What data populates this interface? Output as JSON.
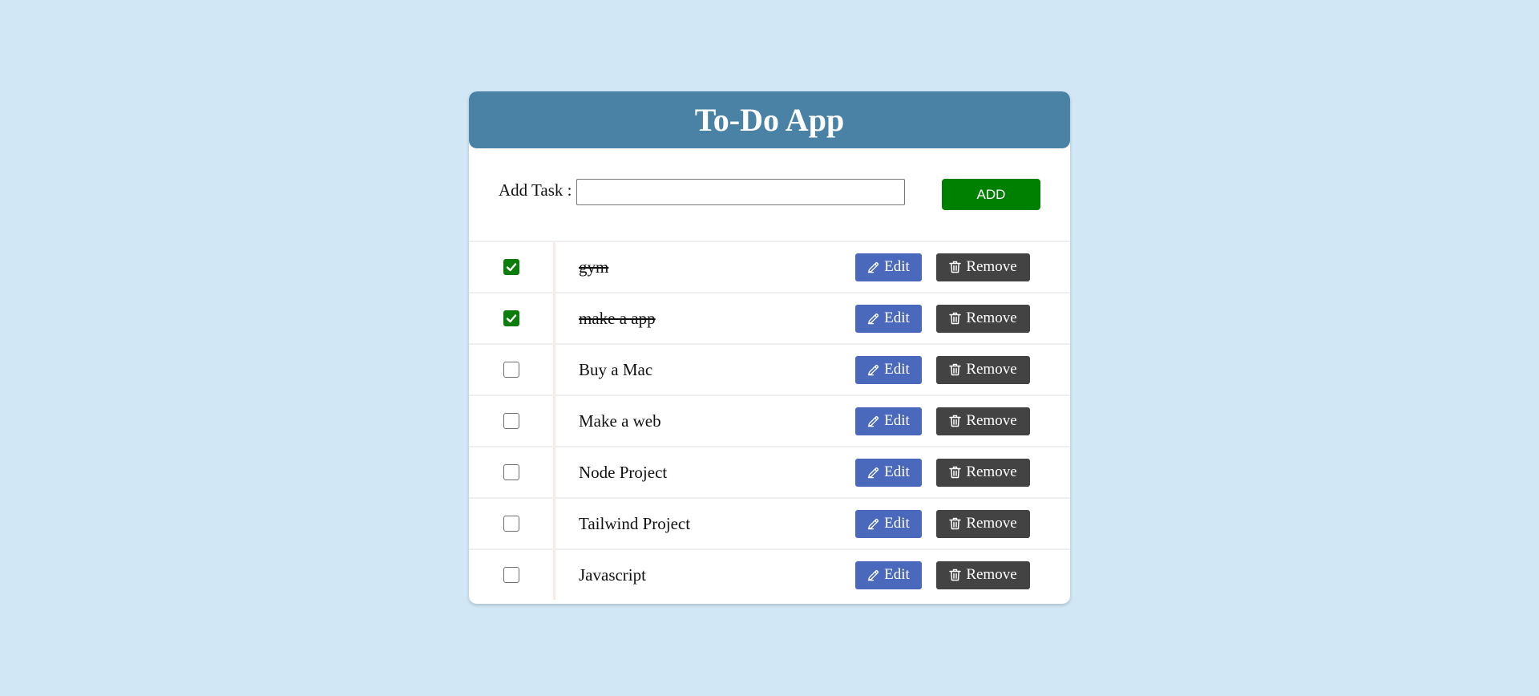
{
  "app": {
    "title": "To-Do App"
  },
  "add_task": {
    "label": "Add Task :",
    "input_value": "",
    "button_label": "ADD"
  },
  "actions": {
    "edit_label": "Edit",
    "remove_label": "Remove",
    "edit_icon": "pencil-icon",
    "remove_icon": "trash-icon"
  },
  "tasks": [
    {
      "text": "gym",
      "completed": true
    },
    {
      "text": "make a app",
      "completed": true
    },
    {
      "text": "Buy a Mac",
      "completed": false
    },
    {
      "text": "Make a web",
      "completed": false
    },
    {
      "text": "Node Project",
      "completed": false
    },
    {
      "text": "Tailwind Project",
      "completed": false
    },
    {
      "text": "Javascript",
      "completed": false
    }
  ],
  "colors": {
    "background": "#d1e7f5",
    "header": "#4a82a6",
    "add_button": "#008000",
    "edit_button": "#4a69bd",
    "remove_button": "#434343",
    "checked": "#0a7d0a"
  }
}
